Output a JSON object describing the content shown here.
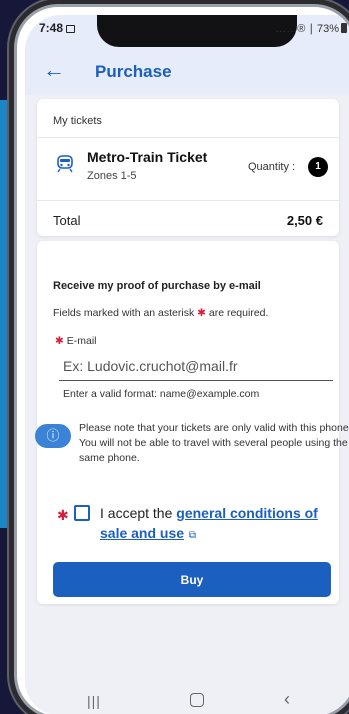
{
  "status": {
    "time": "7:48",
    "signal": "……® ∣ 73%"
  },
  "appbar": {
    "title": "Purchase"
  },
  "tickets": {
    "section_title": "My tickets",
    "ticket_name": "Metro-Train Ticket",
    "zones": "Zones 1-5",
    "quantity_label": "Quantity :",
    "quantity": "1",
    "total_label": "Total",
    "total_value": "2,50 €"
  },
  "email_section": {
    "title": "Receive my proof of purchase by e-mail",
    "required_note_before": "Fields marked with an asterisk",
    "required_note_after": "are required.",
    "email_label": "E-mail",
    "email_placeholder": "Ex: Ludovic.cruchot@mail.fr",
    "email_hint": "Enter a valid format: name@example.com",
    "info_text": "Please note that your tickets are only valid with this phone. You will not be able to travel with several people using the same phone.",
    "accept_prefix": "I accept the",
    "accept_link": "general conditions of sale and use",
    "buy_label": "Buy"
  },
  "colors": {
    "accent": "#1b5fbf",
    "required": "#d61e3c",
    "background": "#17173a",
    "side_panel": "#1a86c7"
  },
  "icons": [
    "back-arrow-icon",
    "ticket-icon",
    "info-icon",
    "external-link-icon",
    "nav-recent-icon",
    "nav-home-icon",
    "nav-back-icon"
  ]
}
